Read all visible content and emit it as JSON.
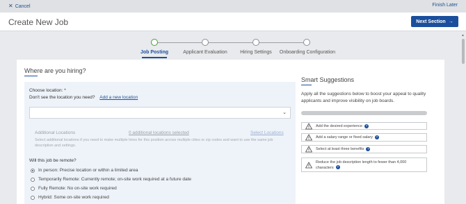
{
  "topbar": {
    "cancel_label": "Cancel",
    "finish_later_label": "Finish Later"
  },
  "header": {
    "title": "Create New Job",
    "next_label": "Next Section"
  },
  "steps": [
    {
      "label": "Job Posting",
      "active": true
    },
    {
      "label": "Applicant Evaluation",
      "active": false
    },
    {
      "label": "Hiring Settings",
      "active": false
    },
    {
      "label": "Onboarding Configuration",
      "active": false
    }
  ],
  "form": {
    "section_title": "Where are you hiring?",
    "choose_location_label": "Choose location: *",
    "missing_location_text": "Don't see the location you need?",
    "add_location_link": "Add a new location",
    "location_value": "",
    "additional_locations_label": "Additional Locations",
    "additional_selected": "0 additional locations selected",
    "select_locations_link": "Select Locations",
    "additional_help": "Select additional locations if you need to make multiple hires for this position across multiple cities or zip codes and want to use the same job description and settings.",
    "remote_question": "Will this job be remote?",
    "remote_options": [
      {
        "label": "In person: Precise location or within a limited area",
        "checked": true
      },
      {
        "label": "Temporarily Remote: Currently remote; on-site work required at a future date",
        "checked": false
      },
      {
        "label": "Fully Remote: No on-site work required",
        "checked": false
      },
      {
        "label": "Hybrid: Some on-site work required",
        "checked": false
      }
    ]
  },
  "smart": {
    "title": "Smart Suggestions",
    "description": "Apply all the suggestions below to boost your appeal to quality applicants and improve visibility on job boards.",
    "progress": 0,
    "suggestions": [
      {
        "text": "Add the desired experience"
      },
      {
        "text": "Add a salary range or fixed salary"
      },
      {
        "text": "Select at least three benefits"
      },
      {
        "text": "Reduce the job description length to fewer than 4,000 characters"
      }
    ]
  },
  "icons": {
    "cancel": "close-icon",
    "next": "arrow-right-icon",
    "dropdown": "chevron-down-icon",
    "warning": "warning-triangle-icon",
    "help": "question-circle-icon"
  },
  "colors": {
    "primary": "#1b4f9c",
    "active_step": "#4a9a3d"
  }
}
